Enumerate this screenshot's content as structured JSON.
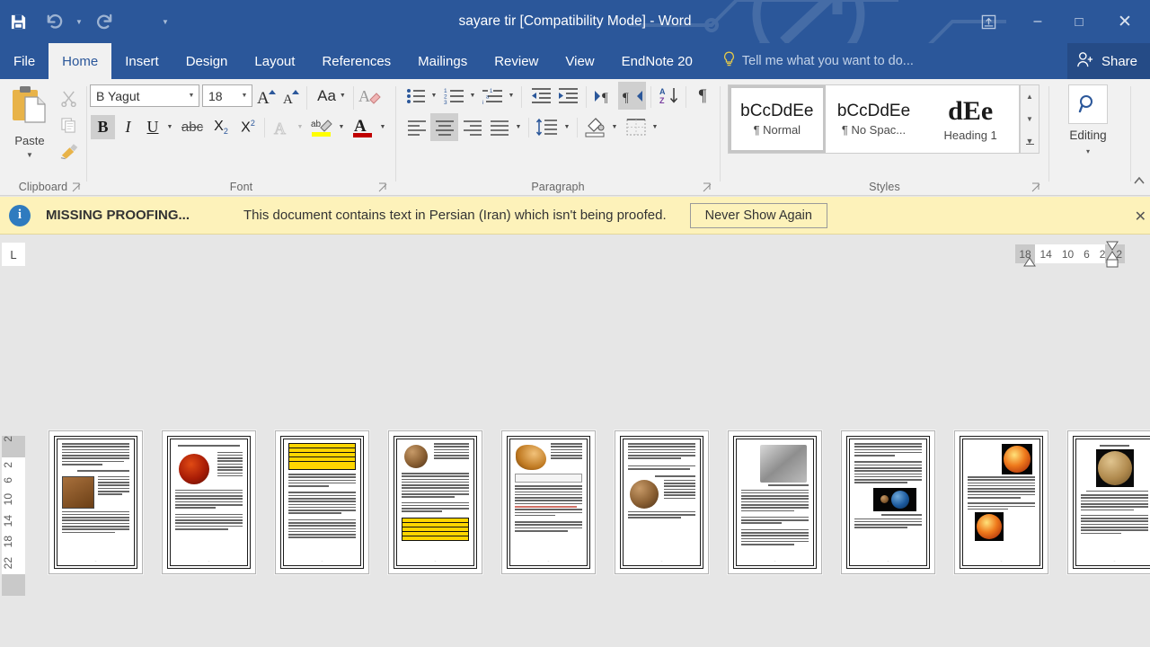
{
  "window": {
    "title": "sayare tir [Compatibility Mode] - Word",
    "minimize_label": "–",
    "restore_label": "□",
    "close_label": "✕",
    "ribbon_display_options": "ribbon-display-options-icon"
  },
  "quick_access": {
    "save": "save-icon",
    "undo": "undo-icon",
    "redo": "redo-icon",
    "customize": "customize-qat-icon"
  },
  "tabs": [
    {
      "label": "File",
      "active": false
    },
    {
      "label": "Home",
      "active": true
    },
    {
      "label": "Insert",
      "active": false
    },
    {
      "label": "Design",
      "active": false
    },
    {
      "label": "Layout",
      "active": false
    },
    {
      "label": "References",
      "active": false
    },
    {
      "label": "Mailings",
      "active": false
    },
    {
      "label": "Review",
      "active": false
    },
    {
      "label": "View",
      "active": false
    },
    {
      "label": "EndNote 20",
      "active": false
    }
  ],
  "tellme": {
    "placeholder": "Tell me what you want to do...",
    "icon": "lightbulb-icon"
  },
  "share": {
    "label": "Share",
    "icon": "share-person-icon"
  },
  "ribbon": {
    "clipboard": {
      "group_label": "Clipboard",
      "paste_label": "Paste",
      "cut": "scissors-icon",
      "copy": "copy-icon",
      "format_painter": "format-painter-icon"
    },
    "font": {
      "group_label": "Font",
      "font_name": "B Yagut",
      "font_size": "18",
      "grow_font": "grow-font-icon",
      "shrink_font": "shrink-font-icon",
      "change_case": "Aa",
      "clear_formatting": "clear-formatting-icon",
      "bold": "B",
      "italic": "I",
      "underline": "U",
      "strikethrough": "abc",
      "subscript": "X₂",
      "superscript": "X²",
      "text_effects": "A",
      "highlight": "ab",
      "font_color": "A",
      "highlight_color": "#ffff00",
      "font_color_value": "#c00000",
      "bold_active": true
    },
    "paragraph": {
      "group_label": "Paragraph",
      "bullets": "bullets-icon",
      "numbering": "numbering-icon",
      "multilevel": "multilevel-list-icon",
      "decrease_indent": "decrease-indent-icon",
      "increase_indent": "increase-indent-icon",
      "ltr": "left-to-right-icon",
      "rtl": "right-to-left-icon",
      "sort": "sort-icon",
      "show_marks": "¶",
      "align_left": "align-left-icon",
      "align_center": "align-center-icon",
      "align_right": "align-right-icon",
      "justify": "justify-icon",
      "line_spacing": "line-spacing-icon",
      "shading": "shading-icon",
      "borders": "borders-icon",
      "rtl_active": true,
      "align_center_active": true
    },
    "styles": {
      "group_label": "Styles",
      "items": [
        {
          "preview": "bCcDdEe",
          "name": "¶ Normal",
          "selected": true,
          "heading": false
        },
        {
          "preview": "bCcDdEe",
          "name": "¶ No Spac...",
          "selected": false,
          "heading": false
        },
        {
          "preview": "dEe",
          "name": "Heading 1",
          "selected": false,
          "heading": true
        }
      ],
      "scroll_up": "▲",
      "scroll_down": "▼",
      "more": "▾"
    },
    "editing": {
      "group_label": "Editing",
      "label": "Editing",
      "icon": "magnifier-icon",
      "caret": "▾"
    }
  },
  "message_bar": {
    "icon": "info-icon",
    "title": "MISSING PROOFING...",
    "body": "This document contains text in Persian (Iran) which isn't being proofed.",
    "button": "Never Show Again",
    "close": "✕"
  },
  "rulers": {
    "tab_stop_marker": "L",
    "horizontal_numbers": [
      "18",
      "14",
      "10",
      "6",
      "2",
      "2"
    ],
    "vertical_numbers": [
      "2",
      "2",
      "6",
      "10",
      "14",
      "18",
      "22"
    ]
  },
  "document": {
    "view": "multiple-pages",
    "page_count": 10,
    "pages": [
      {
        "n": 1,
        "layout": "two-col-image-top"
      },
      {
        "n": 2,
        "layout": "sphere-red-right"
      },
      {
        "n": 3,
        "layout": "yellow-table-top"
      },
      {
        "n": 4,
        "layout": "sphere-brown-table-bottom"
      },
      {
        "n": 5,
        "layout": "cone-image-table"
      },
      {
        "n": 6,
        "layout": "sphere-brown-center"
      },
      {
        "n": 7,
        "layout": "crater-gray-top"
      },
      {
        "n": 8,
        "layout": "two-planets-mid"
      },
      {
        "n": 9,
        "layout": "two-red-spheres"
      },
      {
        "n": 10,
        "layout": "mercury-titled"
      }
    ]
  }
}
